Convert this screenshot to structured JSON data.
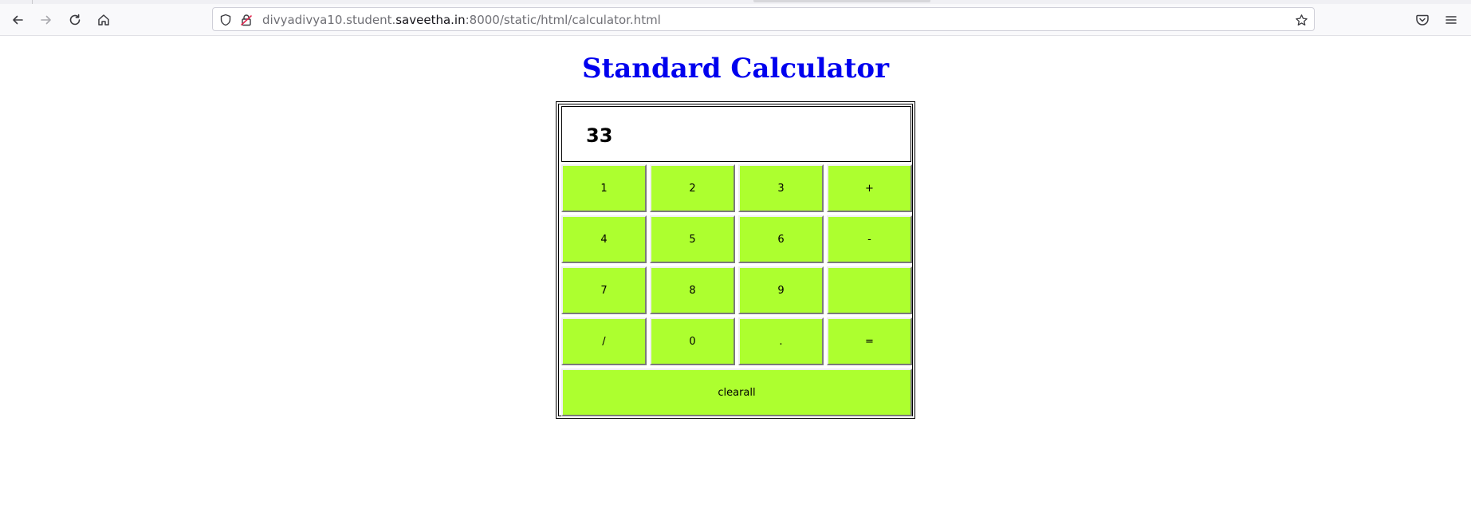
{
  "browser": {
    "url_prefix": "divyadivya10.student.",
    "url_host": "saveetha.in",
    "url_suffix": ":8000/static/html/calculator.html",
    "icons": {
      "back": "arrow-left",
      "forward": "arrow-right",
      "reload": "circular-arrow",
      "home": "house",
      "shield": "shield",
      "lock": "crossed-lock",
      "bookmark": "star",
      "pocket": "pocket",
      "menu": "hamburger"
    }
  },
  "page": {
    "title": "Standard Calculator",
    "title_color": "#0000ee"
  },
  "calculator": {
    "display": "33",
    "key_color": "#adff2f",
    "keys": [
      [
        "1",
        "2",
        "3",
        "+"
      ],
      [
        "4",
        "5",
        "6",
        "-"
      ],
      [
        "7",
        "8",
        "9",
        ""
      ],
      [
        "/",
        "0",
        ".",
        "="
      ]
    ],
    "clear_label": "clearall"
  }
}
